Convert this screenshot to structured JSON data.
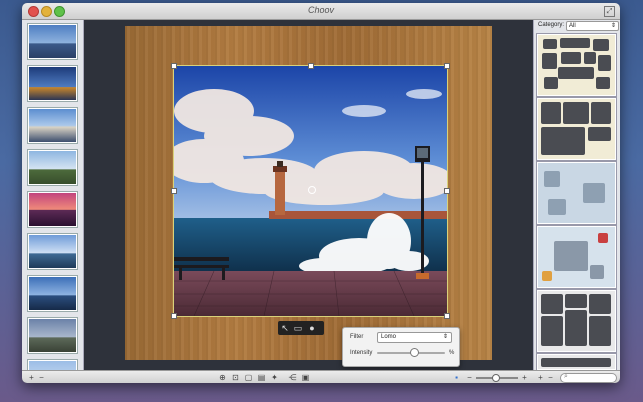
{
  "window": {
    "title": "Choov"
  },
  "left_panel": {
    "thumbnails": [
      "sea-castle",
      "lighthouse-dusk",
      "harbor-sunny",
      "white-lighthouse",
      "pink-sunset-lighthouse",
      "lighthouse-seaside",
      "blue-lighthouse",
      "lighthouse-rocks",
      "lighthouse-sky"
    ]
  },
  "toolbar_tools": [
    "arrow-icon",
    "crop-icon",
    "drop-icon"
  ],
  "filter_popover": {
    "filter_label": "Filter",
    "filter_value": "Lomo",
    "intensity_label": "Intensity",
    "intensity_unit": "%",
    "intensity_level": 0.55
  },
  "right_panel": {
    "category_label": "Category:",
    "category_value": "All"
  },
  "bottom_bar": {
    "add_label": "+",
    "remove_label": "−",
    "zoom_level": 0.45
  },
  "colors": {
    "accent_frame": "#d9d27a",
    "wood": "#a87540"
  }
}
